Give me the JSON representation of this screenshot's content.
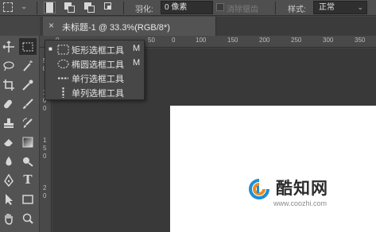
{
  "options_bar": {
    "tool_icon": "rectangular-marquee-icon",
    "feather_label": "羽化:",
    "feather_value": "0 像素",
    "antialias_label": "消除锯齿",
    "style_label": "样式:",
    "style_value": "正常"
  },
  "document": {
    "tab_title": "未标题-1 @ 33.3%(RGB/8*)",
    "close_glyph": "×"
  },
  "rulers": {
    "horizontal": [
      "0",
      "50",
      "0",
      "100",
      "150",
      "200",
      "250",
      "300",
      "350",
      "400"
    ],
    "vertical": [
      "5",
      "0",
      "1",
      "0",
      "0",
      "1",
      "5",
      "0",
      "2",
      "0"
    ]
  },
  "tool_flyout": {
    "items": [
      {
        "label": "矩形选框工具",
        "shortcut": "M",
        "icon": "rectangular-marquee-icon",
        "selected": true
      },
      {
        "label": "椭圆选框工具",
        "shortcut": "M",
        "icon": "elliptical-marquee-icon",
        "selected": false
      },
      {
        "label": "单行选框工具",
        "shortcut": "",
        "icon": "single-row-marquee-icon",
        "selected": false
      },
      {
        "label": "单列选框工具",
        "shortcut": "",
        "icon": "single-column-marquee-icon",
        "selected": false
      }
    ]
  },
  "watermark": {
    "name": "酷知网",
    "url": "www.coozhi.com",
    "logo_colors": {
      "orange": "#f08a1c",
      "blue": "#1c8fd6"
    }
  },
  "toolbox": {
    "tools": [
      "move-icon",
      "marquee-icon",
      "lasso-icon",
      "magic-wand-icon",
      "crop-icon",
      "eyedropper-icon",
      "healing-brush-icon",
      "brush-icon",
      "clone-stamp-icon",
      "history-brush-icon",
      "eraser-icon",
      "gradient-icon",
      "blur-icon",
      "dodge-icon",
      "pen-icon",
      "type-icon",
      "path-select-icon",
      "rectangle-shape-icon",
      "hand-icon",
      "zoom-icon"
    ]
  }
}
